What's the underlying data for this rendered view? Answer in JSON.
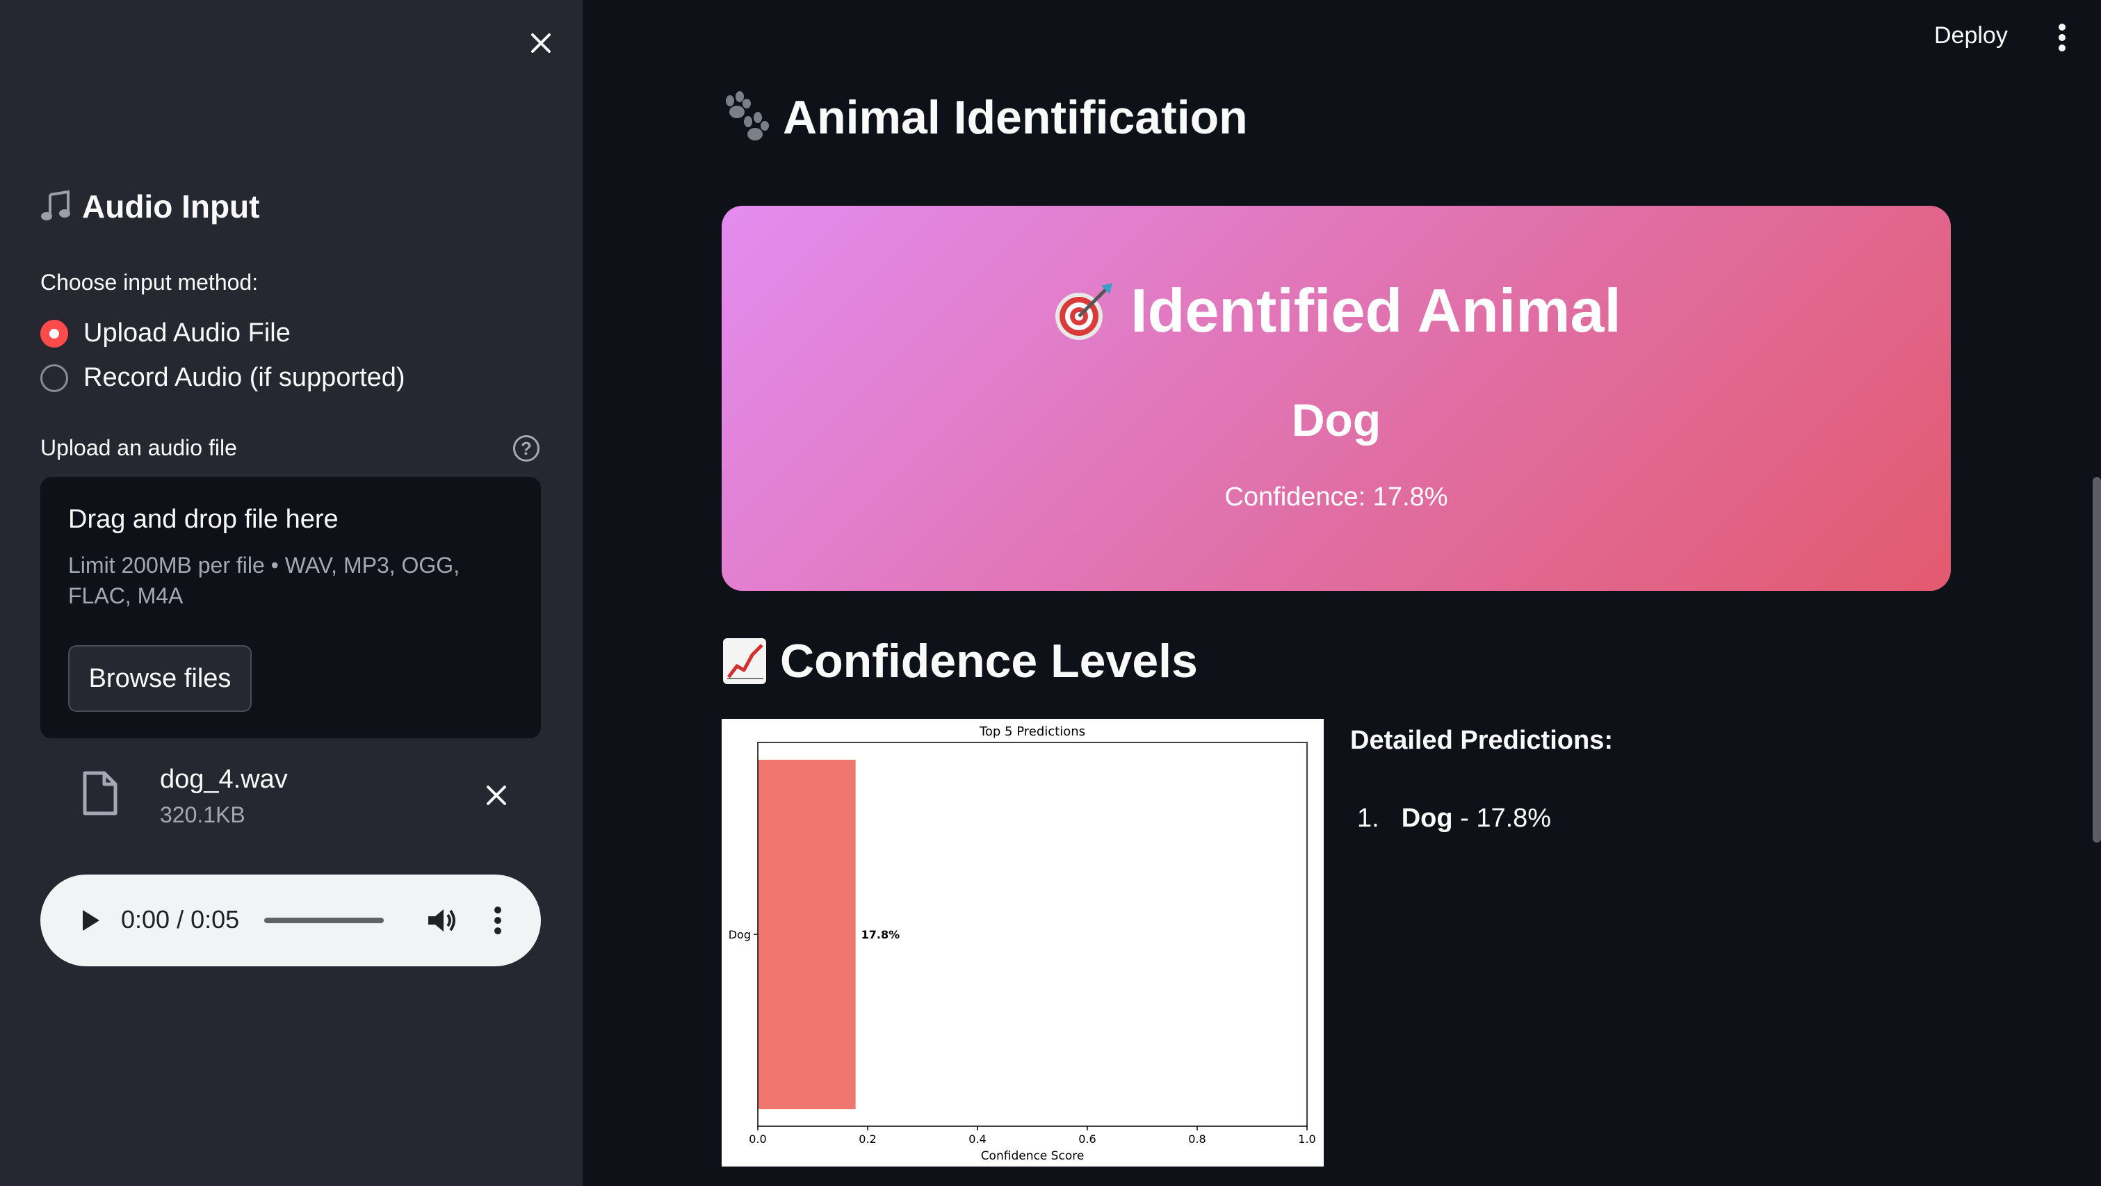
{
  "sidebar": {
    "title": "Audio Input",
    "title_icon": "musical-note-icon",
    "input_method_label": "Choose input method:",
    "options": [
      {
        "label": "Upload Audio File",
        "checked": true
      },
      {
        "label": "Record Audio (if supported)",
        "checked": false
      }
    ],
    "upload_label": "Upload an audio file",
    "dropzone": {
      "title": "Drag and drop file here",
      "limit": "Limit 200MB per file • WAV, MP3, OGG, FLAC, M4A",
      "browse_label": "Browse files"
    },
    "file": {
      "name": "dog_4.wav",
      "size": "320.1KB"
    },
    "player": {
      "time": "0:00 / 0:05"
    }
  },
  "header": {
    "deploy_label": "Deploy"
  },
  "main": {
    "title": "Animal Identification",
    "title_icon": "paw-prints-icon",
    "result": {
      "heading": "Identified Animal",
      "heading_icon": "target-icon",
      "animal": "Dog",
      "confidence": "Confidence: 17.8%"
    },
    "confidence_section": {
      "title": "Confidence Levels",
      "icon": "chart-increasing-icon"
    },
    "detailed": {
      "title": "Detailed Predictions:",
      "items": [
        {
          "rank": "1.",
          "name": "Dog",
          "value": " - 17.8%"
        }
      ]
    }
  },
  "chart_data": {
    "type": "bar",
    "orientation": "horizontal",
    "title": "Top 5 Predictions",
    "xlabel": "Confidence Score",
    "ylabel": "",
    "categories": [
      "Dog"
    ],
    "values": [
      0.178
    ],
    "data_labels": [
      "17.8%"
    ],
    "xlim": [
      0,
      1.0
    ],
    "xticks": [
      "0.0",
      "0.2",
      "0.4",
      "0.6",
      "0.8",
      "1.0"
    ],
    "bar_color": "#ef7770",
    "grid": false
  },
  "colors": {
    "accent": "#ff4b4b",
    "sidebar_bg": "#262730",
    "main_bg": "#0e1117"
  }
}
